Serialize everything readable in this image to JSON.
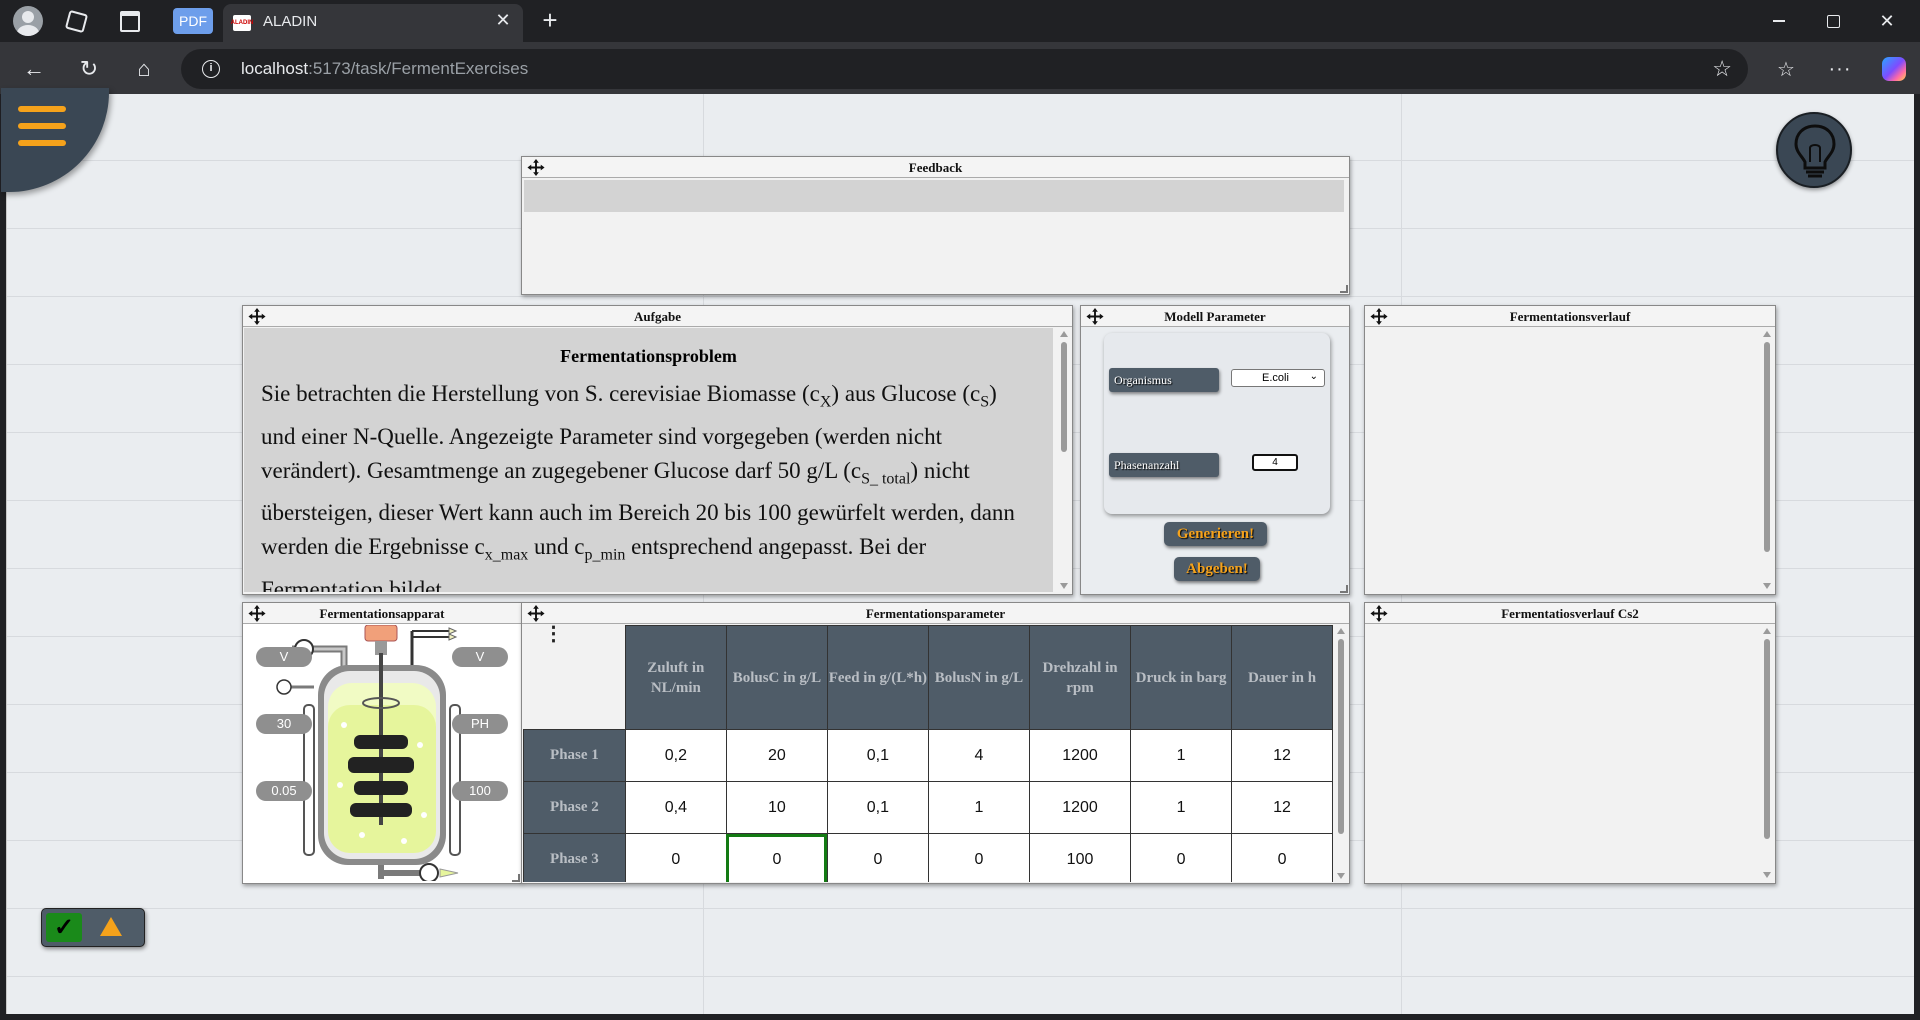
{
  "browser": {
    "pdf_label": "PDF",
    "tab_title": "ALADIN",
    "tab_favicon_text": "ALADIN",
    "url_host": "localhost",
    "url_path": ":5173/task/FermentExercises",
    "icons": {
      "back": "←",
      "reload": "↻",
      "home": "⌂",
      "star": "☆",
      "favorites": "☆",
      "more": "···",
      "close": "✕",
      "new_tab": "+"
    }
  },
  "feedback": {
    "title": "Feedback"
  },
  "aufgabe": {
    "title": "Aufgabe",
    "heading": "Fermentationsproblem"
  },
  "modell": {
    "title": "Modell Parameter",
    "organismus_label": "Organismus",
    "organismus_value": "E.coli",
    "phasen_label": "Phasenanzahl",
    "phasen_value": "4",
    "generate_label": "Generieren!",
    "submit_label": "Abgeben!"
  },
  "verlauf": {
    "title": "Fermentationsverlauf"
  },
  "apparat": {
    "title": "Fermentationsapparat",
    "pills": {
      "left1": "V",
      "right1": "V",
      "left2": "30",
      "right2": "PH",
      "left3": "0.05",
      "right3": "100"
    }
  },
  "parameters": {
    "title": "Fermentationsparameter",
    "columns": [
      "Zuluft in NL/min",
      "BolusC in g/L",
      "Feed in g/(L*h)",
      "BolusN in g/L",
      "Drehzahl in rpm",
      "Druck in barg",
      "Dauer in h"
    ],
    "rows": [
      {
        "label": "Phase 1",
        "values": [
          "0,2",
          "20",
          "0,1",
          "4",
          "1200",
          "1",
          "12"
        ]
      },
      {
        "label": "Phase 2",
        "values": [
          "0,4",
          "10",
          "0,1",
          "1",
          "1200",
          "1",
          "12"
        ]
      },
      {
        "label": "Phase 3",
        "values": [
          "0",
          "0",
          "0",
          "0",
          "100",
          "0",
          "0"
        ]
      }
    ]
  },
  "verlauf2": {
    "title": "Fermentatiosverlauf Cs2"
  },
  "colors": {
    "accent": "#f5a21b",
    "panel_header_dark": "#4f5c68",
    "selected_cell": "#137a13",
    "status_ok": "#1a8a1a"
  }
}
